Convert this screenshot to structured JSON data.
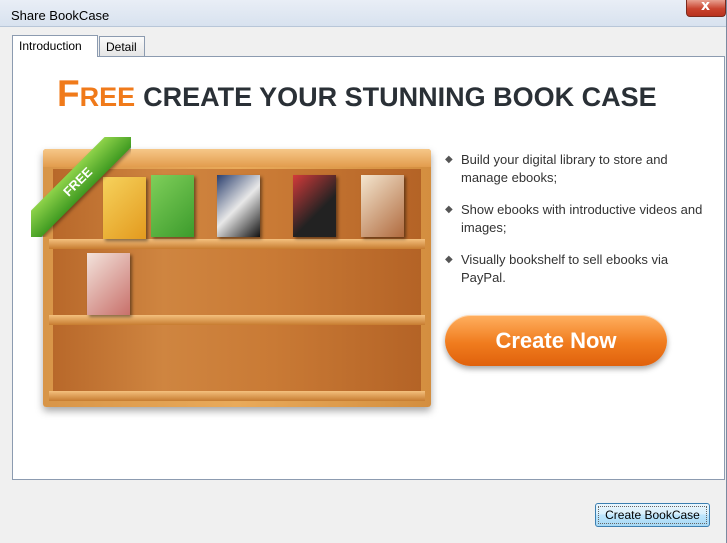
{
  "window": {
    "title": "Share BookCase",
    "close_label": "x"
  },
  "tabs": [
    {
      "label": "Introduction",
      "active": true
    },
    {
      "label": "Detail",
      "active": false
    }
  ],
  "headline": {
    "first_letter": "F",
    "first_rest": "REE",
    "rest": "CREATE YOUR STUNNING BOOK CASE"
  },
  "ribbon": {
    "label": "FREE"
  },
  "features": [
    "Build your digital library to store and manage ebooks;",
    "Show ebooks with introductive videos and images;",
    "Visually bookshelf to sell ebooks via PayPal."
  ],
  "bullet_glyph": "◆",
  "cta": {
    "label": "Create Now"
  },
  "footer": {
    "button_label": "Create BookCase"
  },
  "colors": {
    "accent": "#f07a1a",
    "headline": "#2a3036",
    "ribbon": "#5cb82e"
  }
}
